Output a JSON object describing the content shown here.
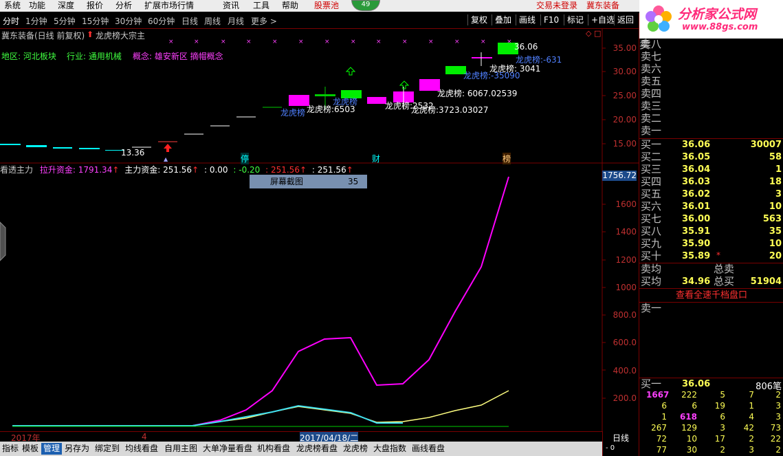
{
  "menu": [
    "系统",
    "功能",
    "深度",
    "报价",
    "分析",
    "扩展市场行情",
    "资讯",
    "工具",
    "帮助",
    "股票池"
  ],
  "badge": "49",
  "login": {
    "status": "交易未登录",
    "stock": "冀东装备"
  },
  "logo": {
    "title": "分析家公式网",
    "url": "www.88gs.com"
  },
  "periods": [
    "分时",
    "1分钟",
    "5分钟",
    "15分钟",
    "30分钟",
    "60分钟",
    "日线",
    "周线",
    "月线",
    "更多 >"
  ],
  "right_buttons": [
    "复权",
    "叠加",
    "画线",
    "F10",
    "标记",
    "+自选",
    "返回"
  ],
  "main_title": "冀东装备(日线 前复权)",
  "main_note": "龙虎榜大宗主",
  "info": {
    "region": "地区: 河北板块",
    "industry": "行业: 通用机械",
    "concept": "概念: 雄安新区 摘帽概念"
  },
  "price_axis": [
    "35.00",
    "30.00",
    "25.00",
    "20.00",
    "15.00"
  ],
  "price_labels": {
    "high": "36.06",
    "low": "13.36"
  },
  "annotations": [
    {
      "text": "龙虎榜:-631",
      "color": "#5080ff"
    },
    {
      "text": "龙虎榜: 3041",
      "color": "#ffffff"
    },
    {
      "text": "龙虎榜:-35090",
      "color": "#5080ff"
    },
    {
      "text": "龙虎榜: 6067.02539",
      "color": "#ffffff"
    },
    {
      "text": "龙虎榜:2532",
      "color": "#ffffff"
    },
    {
      "text": "龙虎榜:3723.03027",
      "color": "#ffffff"
    },
    {
      "text": "龙虎榜:6503",
      "color": "#ffffff"
    },
    {
      "text": "龙虎榜",
      "color": "#5080ff"
    },
    {
      "text": "龙虎榜",
      "color": "#5080ff"
    }
  ],
  "markers": {
    "ting": "停",
    "cai": "财",
    "bang": "榜"
  },
  "indicator": {
    "name": "看透主力",
    "pull_label": "拉升资金: 1791.34",
    "main_label": "主力资金: 251.56",
    "v1": ": 0.00",
    "v2": ": -0.20",
    "v3": ": 251.56",
    "v4": ": 251.56",
    "current": "1756.72"
  },
  "screenshot_box": {
    "label": "屏幕截图",
    "num": "35"
  },
  "ind_axis": [
    "1600",
    "1400",
    "1200",
    "1000",
    "800.0",
    "600.0",
    "400.0",
    "200.0"
  ],
  "dates": {
    "year": "2017年",
    "month": "4",
    "cursor": "2017/04/18/二"
  },
  "tabs": [
    "指标",
    "模板",
    "管理",
    "另存为",
    "绑定到",
    "均线看盘",
    "自用主图",
    "大单净量看盘",
    "机构看盘",
    "龙虎榜看盘",
    "龙虎榜",
    "大盘指数",
    "画线看盘"
  ],
  "period_label": "日线",
  "sell_labels": [
    "卖八",
    "卖七",
    "卖六",
    "卖五",
    "卖四",
    "卖三",
    "卖二",
    "卖一"
  ],
  "bids": [
    {
      "l": "买一",
      "p": "36.06",
      "v": "30007"
    },
    {
      "l": "买二",
      "p": "36.05",
      "v": "58"
    },
    {
      "l": "买三",
      "p": "36.04",
      "v": "1"
    },
    {
      "l": "买四",
      "p": "36.03",
      "v": "18"
    },
    {
      "l": "买五",
      "p": "36.02",
      "v": "3"
    },
    {
      "l": "买六",
      "p": "36.01",
      "v": "10"
    },
    {
      "l": "买七",
      "p": "36.00",
      "v": "563"
    },
    {
      "l": "买八",
      "p": "35.91",
      "v": "35"
    },
    {
      "l": "买九",
      "p": "35.90",
      "v": "10"
    },
    {
      "l": "买十",
      "p": "35.89",
      "v": "20"
    }
  ],
  "avg": {
    "sell_label": "卖均",
    "total_sell": "总卖",
    "buy_label": "买均",
    "buy_avg": "34.96",
    "total_buy": "总买",
    "total_buy_v": "51904"
  },
  "depth_link": "查看全速千档盘口",
  "sell1_label": "卖一",
  "queue_head": {
    "l": "买一",
    "p": "36.06",
    "v": "806笔"
  },
  "queue": [
    [
      "1667",
      "222",
      "5",
      "7",
      "2"
    ],
    [
      "6",
      "6",
      "19",
      "1",
      "3"
    ],
    [
      "1",
      "618",
      "6",
      "4",
      "3"
    ],
    [
      "267",
      "129",
      "3",
      "42",
      "73"
    ],
    [
      "72",
      "10",
      "17",
      "2",
      "22"
    ],
    [
      "77",
      "30",
      "2",
      "3",
      "2"
    ]
  ],
  "colors": {
    "up": "#ff3030",
    "down": "#00ffff",
    "pink": "#ff00ff",
    "yellow": "#ffff80",
    "grid": "#7a0000"
  }
}
